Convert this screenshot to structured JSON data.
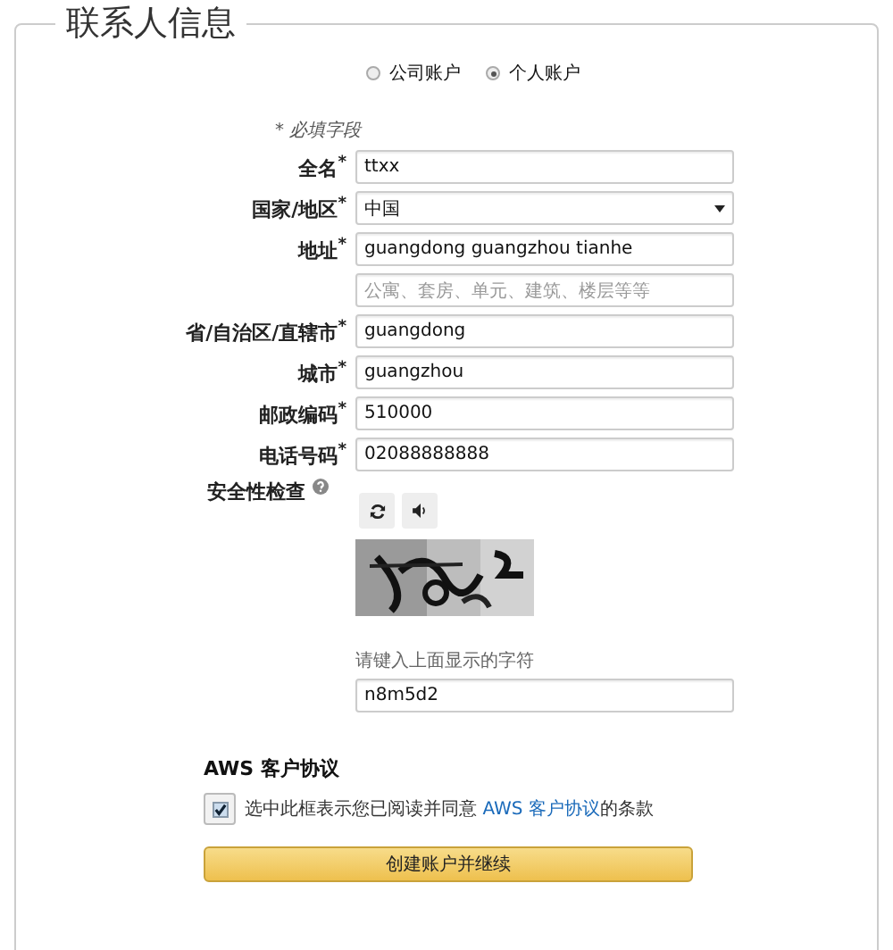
{
  "section": {
    "title": "联系人信息"
  },
  "account_types": [
    {
      "label": "公司账户",
      "selected": false
    },
    {
      "label": "个人账户",
      "selected": true
    }
  ],
  "required_note": "* 必填字段",
  "fields": [
    {
      "kind": "text",
      "label": "全名$^{*}$",
      "value": "ttxx"
    },
    {
      "kind": "select",
      "label": "国家/地区$^{*}$",
      "value": "中国"
    },
    {
      "kind": "text",
      "label": "地址$^{*}$",
      "value": "guangdong guangzhou tianhe"
    },
    {
      "kind": "text",
      "placeholder": "公寓、套房、单元、建筑、楼层等等"
    },
    {
      "kind": "text",
      "label": "省/自治区/直辖市$^{*}$",
      "value": "guangdong"
    },
    {
      "kind": "text",
      "label": "城市$^{*}$",
      "value": "guangzhou"
    },
    {
      "kind": "text",
      "label": "邮政编码$^{*}$",
      "value": "510000"
    },
    {
      "kind": "text",
      "label": "电话号码$^{*}$",
      "value": "02088888888"
    }
  ],
  "security": {
    "label": "安全性检查",
    "hint": "请键入上面显示的字符",
    "value": "n8m5d2"
  },
  "agreement": {
    "title": "AWS 客户协议",
    "checked": true,
    "text_before": "选中此框表示您已阅读并同意 ",
    "link": "AWS 客户协议",
    "text_after": "的条款"
  },
  "submit": "创建账户并继续"
}
